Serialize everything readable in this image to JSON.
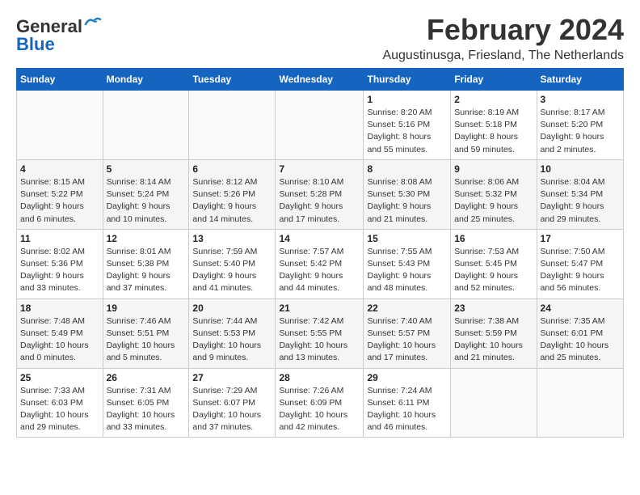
{
  "header": {
    "logo_line1": "General",
    "logo_line2": "Blue",
    "month_title": "February 2024",
    "location": "Augustinusga, Friesland, The Netherlands"
  },
  "weekdays": [
    "Sunday",
    "Monday",
    "Tuesday",
    "Wednesday",
    "Thursday",
    "Friday",
    "Saturday"
  ],
  "weeks": [
    [
      {
        "day": "",
        "info": ""
      },
      {
        "day": "",
        "info": ""
      },
      {
        "day": "",
        "info": ""
      },
      {
        "day": "",
        "info": ""
      },
      {
        "day": "1",
        "info": "Sunrise: 8:20 AM\nSunset: 5:16 PM\nDaylight: 8 hours\nand 55 minutes."
      },
      {
        "day": "2",
        "info": "Sunrise: 8:19 AM\nSunset: 5:18 PM\nDaylight: 8 hours\nand 59 minutes."
      },
      {
        "day": "3",
        "info": "Sunrise: 8:17 AM\nSunset: 5:20 PM\nDaylight: 9 hours\nand 2 minutes."
      }
    ],
    [
      {
        "day": "4",
        "info": "Sunrise: 8:15 AM\nSunset: 5:22 PM\nDaylight: 9 hours\nand 6 minutes."
      },
      {
        "day": "5",
        "info": "Sunrise: 8:14 AM\nSunset: 5:24 PM\nDaylight: 9 hours\nand 10 minutes."
      },
      {
        "day": "6",
        "info": "Sunrise: 8:12 AM\nSunset: 5:26 PM\nDaylight: 9 hours\nand 14 minutes."
      },
      {
        "day": "7",
        "info": "Sunrise: 8:10 AM\nSunset: 5:28 PM\nDaylight: 9 hours\nand 17 minutes."
      },
      {
        "day": "8",
        "info": "Sunrise: 8:08 AM\nSunset: 5:30 PM\nDaylight: 9 hours\nand 21 minutes."
      },
      {
        "day": "9",
        "info": "Sunrise: 8:06 AM\nSunset: 5:32 PM\nDaylight: 9 hours\nand 25 minutes."
      },
      {
        "day": "10",
        "info": "Sunrise: 8:04 AM\nSunset: 5:34 PM\nDaylight: 9 hours\nand 29 minutes."
      }
    ],
    [
      {
        "day": "11",
        "info": "Sunrise: 8:02 AM\nSunset: 5:36 PM\nDaylight: 9 hours\nand 33 minutes."
      },
      {
        "day": "12",
        "info": "Sunrise: 8:01 AM\nSunset: 5:38 PM\nDaylight: 9 hours\nand 37 minutes."
      },
      {
        "day": "13",
        "info": "Sunrise: 7:59 AM\nSunset: 5:40 PM\nDaylight: 9 hours\nand 41 minutes."
      },
      {
        "day": "14",
        "info": "Sunrise: 7:57 AM\nSunset: 5:42 PM\nDaylight: 9 hours\nand 44 minutes."
      },
      {
        "day": "15",
        "info": "Sunrise: 7:55 AM\nSunset: 5:43 PM\nDaylight: 9 hours\nand 48 minutes."
      },
      {
        "day": "16",
        "info": "Sunrise: 7:53 AM\nSunset: 5:45 PM\nDaylight: 9 hours\nand 52 minutes."
      },
      {
        "day": "17",
        "info": "Sunrise: 7:50 AM\nSunset: 5:47 PM\nDaylight: 9 hours\nand 56 minutes."
      }
    ],
    [
      {
        "day": "18",
        "info": "Sunrise: 7:48 AM\nSunset: 5:49 PM\nDaylight: 10 hours\nand 0 minutes."
      },
      {
        "day": "19",
        "info": "Sunrise: 7:46 AM\nSunset: 5:51 PM\nDaylight: 10 hours\nand 5 minutes."
      },
      {
        "day": "20",
        "info": "Sunrise: 7:44 AM\nSunset: 5:53 PM\nDaylight: 10 hours\nand 9 minutes."
      },
      {
        "day": "21",
        "info": "Sunrise: 7:42 AM\nSunset: 5:55 PM\nDaylight: 10 hours\nand 13 minutes."
      },
      {
        "day": "22",
        "info": "Sunrise: 7:40 AM\nSunset: 5:57 PM\nDaylight: 10 hours\nand 17 minutes."
      },
      {
        "day": "23",
        "info": "Sunrise: 7:38 AM\nSunset: 5:59 PM\nDaylight: 10 hours\nand 21 minutes."
      },
      {
        "day": "24",
        "info": "Sunrise: 7:35 AM\nSunset: 6:01 PM\nDaylight: 10 hours\nand 25 minutes."
      }
    ],
    [
      {
        "day": "25",
        "info": "Sunrise: 7:33 AM\nSunset: 6:03 PM\nDaylight: 10 hours\nand 29 minutes."
      },
      {
        "day": "26",
        "info": "Sunrise: 7:31 AM\nSunset: 6:05 PM\nDaylight: 10 hours\nand 33 minutes."
      },
      {
        "day": "27",
        "info": "Sunrise: 7:29 AM\nSunset: 6:07 PM\nDaylight: 10 hours\nand 37 minutes."
      },
      {
        "day": "28",
        "info": "Sunrise: 7:26 AM\nSunset: 6:09 PM\nDaylight: 10 hours\nand 42 minutes."
      },
      {
        "day": "29",
        "info": "Sunrise: 7:24 AM\nSunset: 6:11 PM\nDaylight: 10 hours\nand 46 minutes."
      },
      {
        "day": "",
        "info": ""
      },
      {
        "day": "",
        "info": ""
      }
    ]
  ]
}
